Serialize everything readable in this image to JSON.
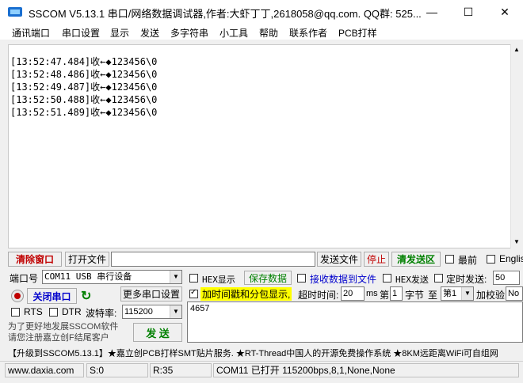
{
  "title": "SSCOM V5.13.1 串口/网络数据调试器,作者:大虾丁丁,2618058@qq.com. QQ群: 525...",
  "window_controls": {
    "minimize": "—",
    "maximize": "☐",
    "close": "✕"
  },
  "menu": [
    "通讯端口",
    "串口设置",
    "显示",
    "发送",
    "多字符串",
    "小工具",
    "帮助",
    "联系作者",
    "PCB打样"
  ],
  "output_lines": [
    "[13:52:47.484]收←◆123456\\0",
    "[13:52:48.486]收←◆123456\\0",
    "[13:52:49.487]收←◆123456\\0",
    "[13:52:50.488]收←◆123456\\0",
    "[13:52:51.489]收←◆123456\\0"
  ],
  "toolbar": {
    "clear_window": "清除窗口",
    "open_file": "打开文件",
    "send_file": "发送文件",
    "stop": "停止",
    "clear_send": "清发送区",
    "topmost": "最前",
    "english": "English"
  },
  "port": {
    "label": "端口号",
    "value": "COM11 USB 串行设备",
    "close_port": "关闭串口",
    "more_settings": "更多串口设置",
    "rts": "RTS",
    "dtr": "DTR",
    "baud_label": "波特率:",
    "baud_value": "115200",
    "promo": "为了更好地发展SSCOM软件\n请您注册嘉立创F结尾客户",
    "send": "发 送"
  },
  "options": {
    "hex_display": "HEX显示",
    "save_data": "保存数据",
    "recv_to_file": "接收数据到文件",
    "hex_send": "HEX发送",
    "timed_send": "定时发送:",
    "timed_value": "50",
    "timestamp": "加时间戳和分包显示,",
    "timeout_label": "超时时间:",
    "timeout_value": "20",
    "timeout_unit": "ms",
    "byte_prefix": "第",
    "byte_value": "1",
    "byte_label": "字节",
    "to_label": "至",
    "to_value": "第1",
    "checksum_label": "加校验",
    "checksum_value": "No"
  },
  "send_text": "4657",
  "adbar": "【升级到SSCOM5.13.1】★嘉立创PCB打样SMT贴片服务. ★RT-Thread中国人的开源免费操作系统 ★8KM远距离WiFi可自组网",
  "status": {
    "website": "www.daxia.com",
    "sent": "S:0",
    "received": "R:35",
    "port_state": "COM11 已打开  115200bps,8,1,None,None"
  },
  "colors": {
    "accent_red": "#c00000",
    "accent_green": "#008000",
    "highlight": "#ffff00",
    "link_blue": "#0000cc"
  }
}
